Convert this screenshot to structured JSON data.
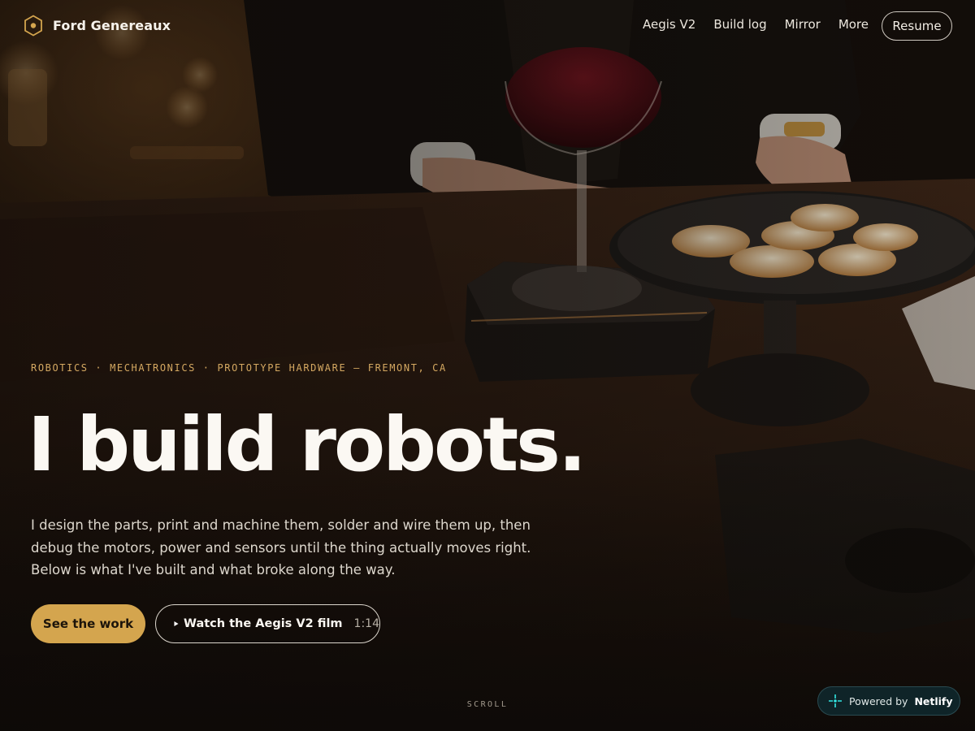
{
  "brand": {
    "name": "Ford Genereaux",
    "accent": "#d4a54e",
    "mark_icon": "hexagon-dot-icon"
  },
  "nav": {
    "links": [
      "Aegis V2",
      "Build log",
      "Mirror",
      "More"
    ],
    "resume_label": "Resume"
  },
  "hero": {
    "kicker": "ROBOTICS · MECHATRONICS · PROTOTYPE HARDWARE — FREMONT, CA",
    "headline": "I build robots.",
    "lede": "I design the parts, print and machine them, solder and wire them up, then debug the motors, power and sensors until the thing actually moves right. Below is what I've built and what broke along the way.",
    "cta_primary": "See the work",
    "cta_film_label": "Watch the Aegis V2 film",
    "cta_film_duration": "1:14",
    "play_icon": "play-icon",
    "scroll_hint": "SCROLL"
  },
  "badge": {
    "prefix": "Powered by",
    "brand": "Netlify",
    "icon": "netlify-icon"
  },
  "colors": {
    "background": "#100c09",
    "kicker": "#d4a861",
    "netlify_badge_bg": "#0f2428"
  }
}
